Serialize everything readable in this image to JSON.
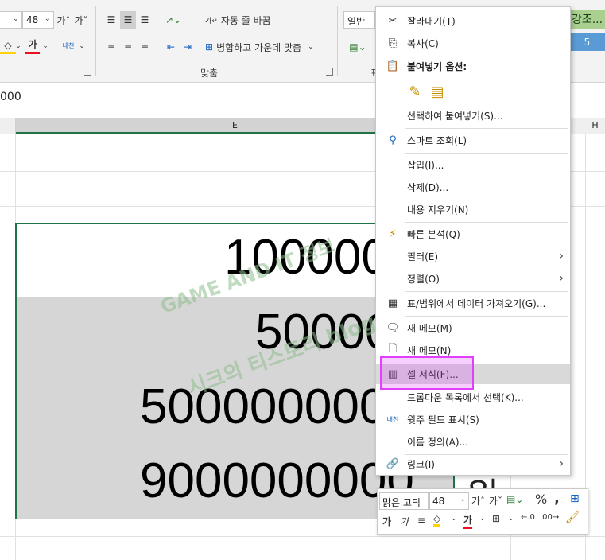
{
  "ribbon": {
    "font_size": "48",
    "grow_font": "가ˆ",
    "shrink_font": "가ˇ",
    "font_color_glyph": "가",
    "phonetic_glyph": "내천",
    "wrap_text": "자동 줄 바꿈",
    "merge_center": "병합하고 가운데 맞춤",
    "alignment_group": "맞춤",
    "number_format": "일반",
    "style_label": "강조...",
    "style_value": "5",
    "group_cut": "표"
  },
  "formula_bar": {
    "value": "000"
  },
  "grid": {
    "columns": [
      "E",
      "H"
    ],
    "cells": [
      "100000",
      "50000",
      "5000000000",
      "9000000000"
    ],
    "cell_suffix": "원"
  },
  "context_menu": {
    "items": [
      {
        "icon": "scissors-icon",
        "label": "잘라내기(T)"
      },
      {
        "icon": "copy-icon",
        "label": "복사(C)"
      },
      {
        "icon": "paste-icon",
        "label": "붙여넣기 옵션:",
        "bold": true
      },
      {
        "icon": "",
        "label": "선택하여 붙여넣기(S)..."
      },
      {
        "icon": "smart-lookup-icon",
        "label": "스마트 조회(L)"
      },
      {
        "icon": "",
        "label": "삽입(I)..."
      },
      {
        "icon": "",
        "label": "삭제(D)..."
      },
      {
        "icon": "",
        "label": "내용 지우기(N)"
      },
      {
        "icon": "quick-analysis-icon",
        "label": "빠른 분석(Q)"
      },
      {
        "icon": "",
        "label": "필터(E)",
        "submenu": true
      },
      {
        "icon": "",
        "label": "정렬(O)",
        "submenu": true
      },
      {
        "icon": "table-icon",
        "label": "표/범위에서 데이터 가져오기(G)..."
      },
      {
        "icon": "new-comment-icon",
        "label": "새 메모(M)"
      },
      {
        "icon": "new-note-icon",
        "label": "새 메모(N)"
      },
      {
        "icon": "format-cells-icon",
        "label": "셀 서식(F)..."
      },
      {
        "icon": "",
        "label": "드롭다운 목록에서 선택(K)..."
      },
      {
        "icon": "phonetic-icon",
        "label": "윗주 필드 표시(S)"
      },
      {
        "icon": "",
        "label": "이름 정의(A)..."
      },
      {
        "icon": "link-icon",
        "label": "링크(I)",
        "submenu": true
      }
    ]
  },
  "mini_toolbar": {
    "font_name": "맑은 고딕",
    "font_size": "48",
    "percent": "%",
    "comma": ","
  },
  "watermark": {
    "line1": "GAME AND IT 정보",
    "line2": "시크의 티스토리 blog.stiz.com"
  },
  "colors": {
    "highlight": "#e040fb",
    "selection_border": "#217346",
    "cell_fill": "#d6d6d6"
  }
}
